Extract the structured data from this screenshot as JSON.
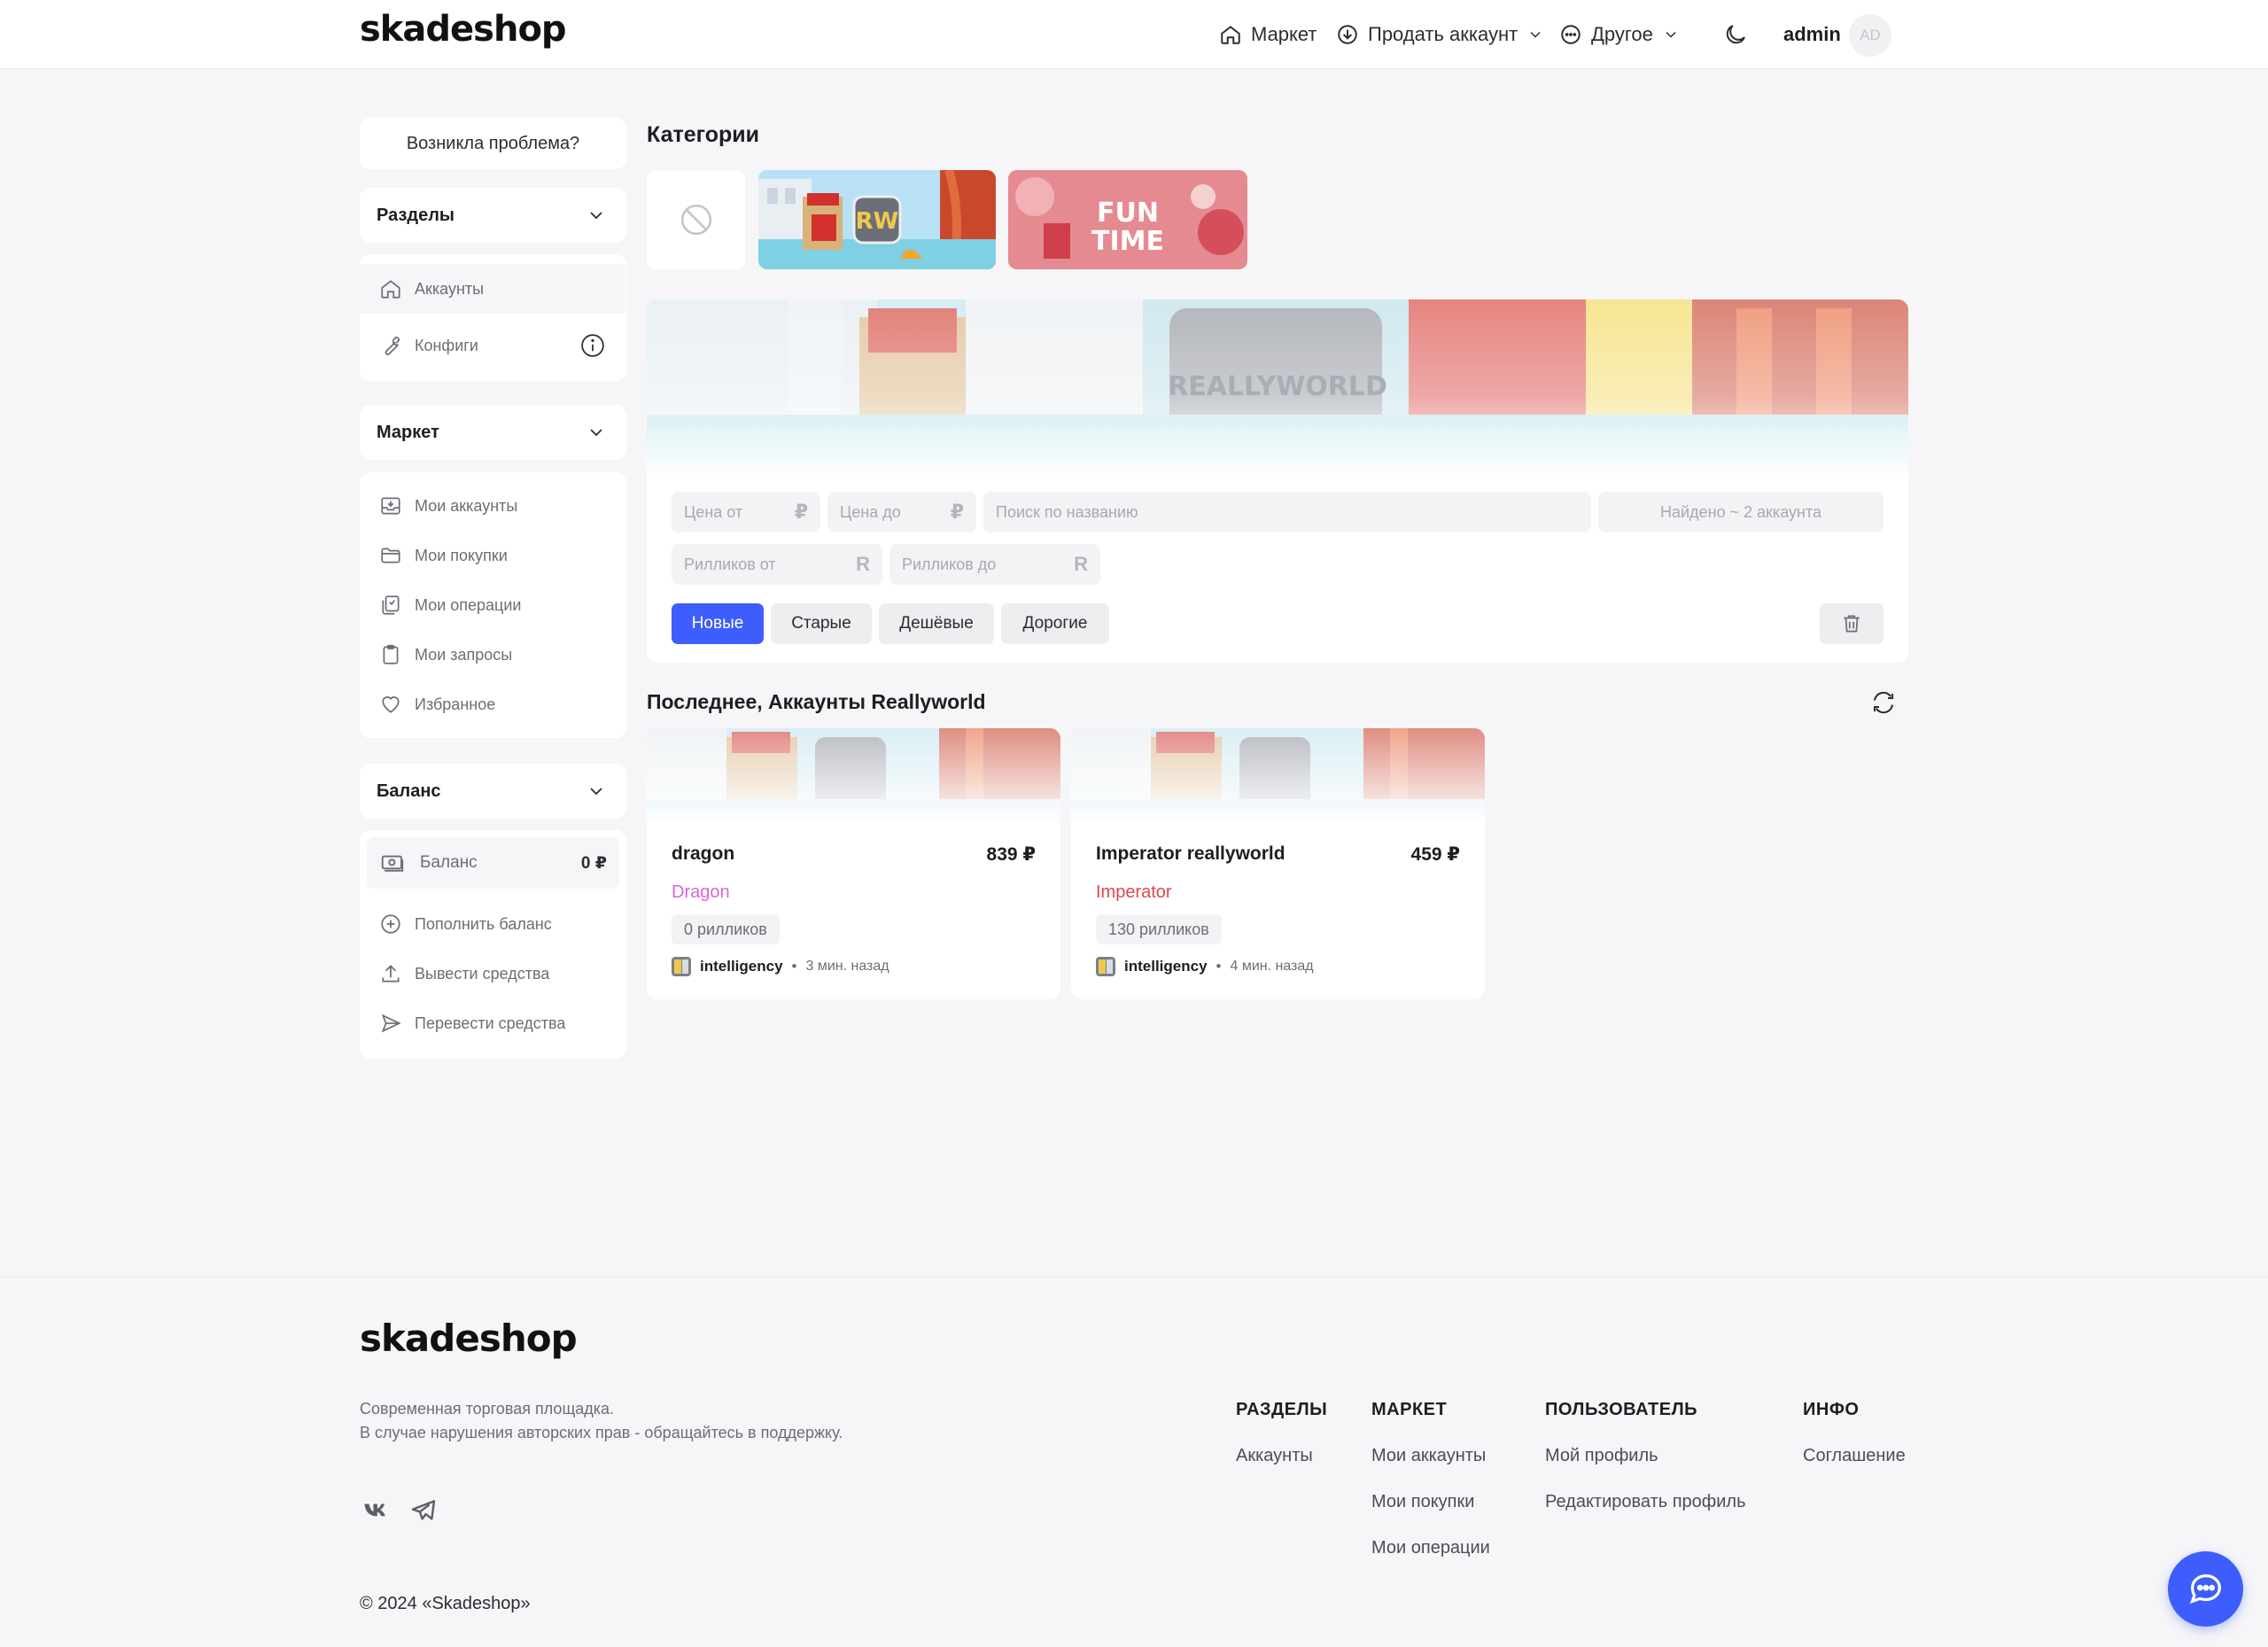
{
  "header": {
    "logo": "skadeshop",
    "nav": {
      "market": "Маркет",
      "sell": "Продать аккаунт",
      "other": "Другое"
    },
    "user": "admin",
    "avatar_initials": "AD"
  },
  "sidebar": {
    "problem_button": "Возникла проблема?",
    "sections": {
      "title": "Разделы",
      "items": [
        "Аккаунты",
        "Конфиги"
      ]
    },
    "market": {
      "title": "Маркет",
      "items": [
        "Мои аккаунты",
        "Мои покупки",
        "Мои операции",
        "Мои запросы",
        "Избранное"
      ]
    },
    "balance": {
      "title": "Баланс",
      "label": "Баланс",
      "amount": "0 ₽",
      "items": [
        "Пополнить баланс",
        "Вывести средства",
        "Перевести средства"
      ]
    }
  },
  "categories": {
    "title": "Категории",
    "items": [
      {
        "name": "none",
        "icon": "ban-icon"
      },
      {
        "name": "reallyworld",
        "label": "RW"
      },
      {
        "name": "funtime",
        "label": "FUN TIME"
      }
    ],
    "banner_text": "REALLYWORLD"
  },
  "filters": {
    "price_from": "Цена от",
    "price_to": "Цена до",
    "price_unit": "₽",
    "search_placeholder": "Поиск по названию",
    "found": "Найдено ~ 2 аккаунта",
    "rillik_from": "Рилликов от",
    "rillik_to": "Рилликов до",
    "rillik_unit": "R",
    "sort": [
      "Новые",
      "Старые",
      "Дешёвые",
      "Дорогие"
    ],
    "sort_active": "Новые"
  },
  "latest": {
    "title": "Последнее, Аккаунты Reallyworld",
    "accounts": [
      {
        "title": "dragon",
        "price": "839 ₽",
        "rank": "Dragon",
        "rank_color": "#d966d6",
        "rilliks": "0 рилликов",
        "seller": "intelligency",
        "dot": "•",
        "time": "3 мин. назад"
      },
      {
        "title": "Imperator reallyworld",
        "price": "459 ₽",
        "rank": "Imperator",
        "rank_color": "#e0474c",
        "rilliks": "130 рилликов",
        "seller": "intelligency",
        "dot": "•",
        "time": "4 мин. назад"
      }
    ]
  },
  "footer": {
    "logo": "skadeshop",
    "desc1": "Современная торговая площадка.",
    "desc2": "В случае нарушения авторских прав - обращайтесь в поддержку.",
    "copyright": "© 2024 «Skadeshop»",
    "columns": [
      {
        "title": "РАЗДЕЛЫ",
        "links": [
          "Аккаунты"
        ]
      },
      {
        "title": "МАРКЕТ",
        "links": [
          "Мои аккаунты",
          "Мои покупки",
          "Мои операции"
        ]
      },
      {
        "title": "ПОЛЬЗОВАТЕЛЬ",
        "links": [
          "Мой профиль",
          "Редактировать профиль"
        ]
      },
      {
        "title": "ИНФО",
        "links": [
          "Соглашение"
        ]
      }
    ]
  },
  "colors": {
    "accent": "#3d5efc",
    "background": "#f6f6f8"
  }
}
